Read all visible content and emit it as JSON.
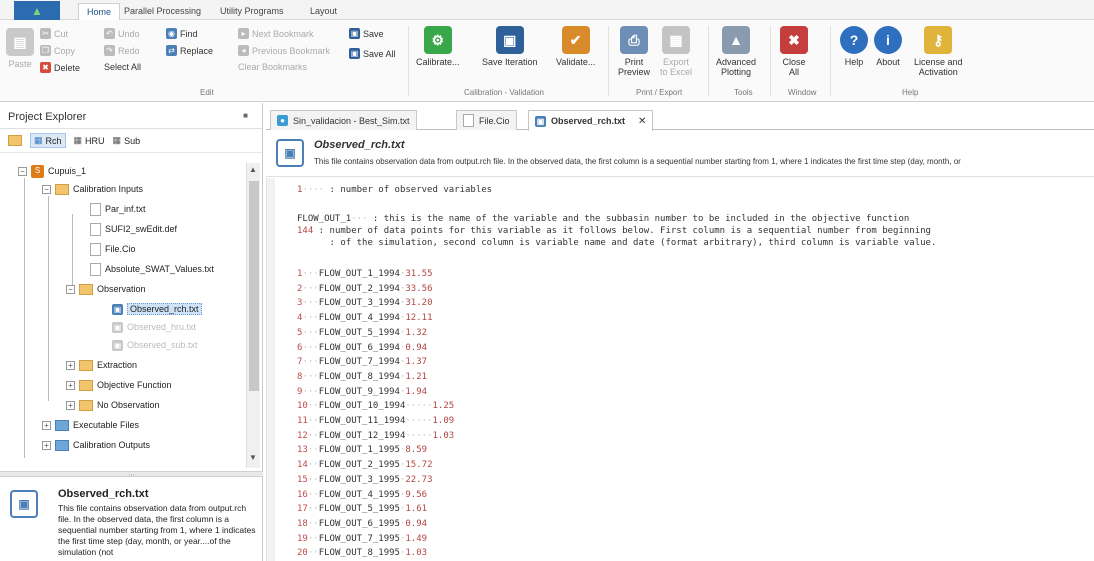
{
  "ribbon": {
    "tabs": [
      "Home",
      "Parallel Processing",
      "Utility Programs",
      "Layout"
    ],
    "clipboard": {
      "paste": "Paste",
      "cut": "Cut",
      "copy": "Copy",
      "delete": "Delete"
    },
    "edit": {
      "undo": "Undo",
      "redo": "Redo",
      "select_all": "Select All",
      "find": "Find",
      "replace": "Replace",
      "group": "Edit"
    },
    "bookmarks": {
      "next": "Next Bookmark",
      "previous": "Previous Bookmark",
      "clear": "Clear Bookmarks"
    },
    "save": {
      "save": "Save",
      "save_all": "Save All"
    },
    "calibration": {
      "calibrate": "Calibrate...",
      "save_iteration": "Save Iteration",
      "validate": "Validate...",
      "group": "Calibration - Validation"
    },
    "print": {
      "preview_1": "Print",
      "preview_2": "Preview",
      "export_1": "Export",
      "export_2": "to Excel",
      "group": "Print / Export"
    },
    "tools": {
      "adv_1": "Advanced",
      "adv_2": "Plotting",
      "group": "Tools"
    },
    "window": {
      "close_1": "Close",
      "close_2": "All",
      "group": "Window"
    },
    "help": {
      "help": "Help",
      "about": "About",
      "license_1": "License and",
      "license_2": "Activation",
      "group": "Help"
    }
  },
  "project_explorer": {
    "title": "Project Explorer",
    "filters": [
      "Rch",
      "HRU",
      "Sub"
    ],
    "tree": {
      "root": "Cupuis_1",
      "calibration_inputs": "Calibration Inputs",
      "par_inf": "Par_inf.txt",
      "sufi2": "SUFI2_swEdit.def",
      "file_cio": "File.Cio",
      "absolute": "Absolute_SWAT_Values.txt",
      "observation": "Observation",
      "observed_rch": "Observed_rch.txt",
      "observed_hru": "Observed_hru.txt",
      "observed_sub": "Observed_sub.txt",
      "extraction": "Extraction",
      "objective": "Objective Function",
      "no_observation": "No Observation",
      "executable": "Executable Files",
      "calibration_outputs": "Calibration Outputs"
    },
    "description": {
      "title": "Observed_rch.txt",
      "text": "This file contains observation data from output.rch file. In the observed data, the first column is a sequential number starting from 1, where 1 indicates the first time step (day, month, or year....of the simulation (not"
    }
  },
  "document_tabs": [
    "Sin_validacion - Best_Sim.txt",
    "File.Cio",
    "Observed_rch.txt"
  ],
  "document": {
    "title": "Observed_rch.txt",
    "subtitle": "This file contains observation data from output.rch file. In the observed data, the first column is a sequential number starting from 1, where 1 indicates the first time step (day, month, or"
  },
  "editor": {
    "header": [
      {
        "n": "1",
        "rest": " : number of observed variables"
      },
      {
        "n": "FLOW_OUT_1",
        "rest": " : this is the name of the variable and the subbasin number to be included in the objective function"
      },
      {
        "n": "144",
        "rest": " : number of data points for this variable as it follows below. First column is a sequential number from beginning"
      },
      {
        "n": "",
        "rest": "      : of the simulation, second column is variable name and date (format arbitrary), third column is variable value."
      }
    ],
    "rows": [
      [
        "1",
        "FLOW_OUT_1_1994",
        "31.55"
      ],
      [
        "2",
        "FLOW_OUT_2_1994",
        "33.56"
      ],
      [
        "3",
        "FLOW_OUT_3_1994",
        "31.20"
      ],
      [
        "4",
        "FLOW_OUT_4_1994",
        "12.11"
      ],
      [
        "5",
        "FLOW_OUT_5_1994",
        "1.32"
      ],
      [
        "6",
        "FLOW_OUT_6_1994",
        "0.94"
      ],
      [
        "7",
        "FLOW_OUT_7_1994",
        "1.37"
      ],
      [
        "8",
        "FLOW_OUT_8_1994",
        "1.21"
      ],
      [
        "9",
        "FLOW_OUT_9_1994",
        "1.94"
      ],
      [
        "10",
        "FLOW_OUT_10_1994",
        "1.25"
      ],
      [
        "11",
        "FLOW_OUT_11_1994",
        "1.09"
      ],
      [
        "12",
        "FLOW_OUT_12_1994",
        "1.03"
      ],
      [
        "13",
        "FLOW_OUT_1_1995",
        "8.59"
      ],
      [
        "14",
        "FLOW_OUT_2_1995",
        "15.72"
      ],
      [
        "15",
        "FLOW_OUT_3_1995",
        "22.73"
      ],
      [
        "16",
        "FLOW_OUT_4_1995",
        "9.56"
      ],
      [
        "17",
        "FLOW_OUT_5_1995",
        "1.61"
      ],
      [
        "18",
        "FLOW_OUT_6_1995",
        "0.94"
      ],
      [
        "19",
        "FLOW_OUT_7_1995",
        "1.49"
      ],
      [
        "20",
        "FLOW_OUT_8_1995",
        "1.03"
      ]
    ]
  }
}
